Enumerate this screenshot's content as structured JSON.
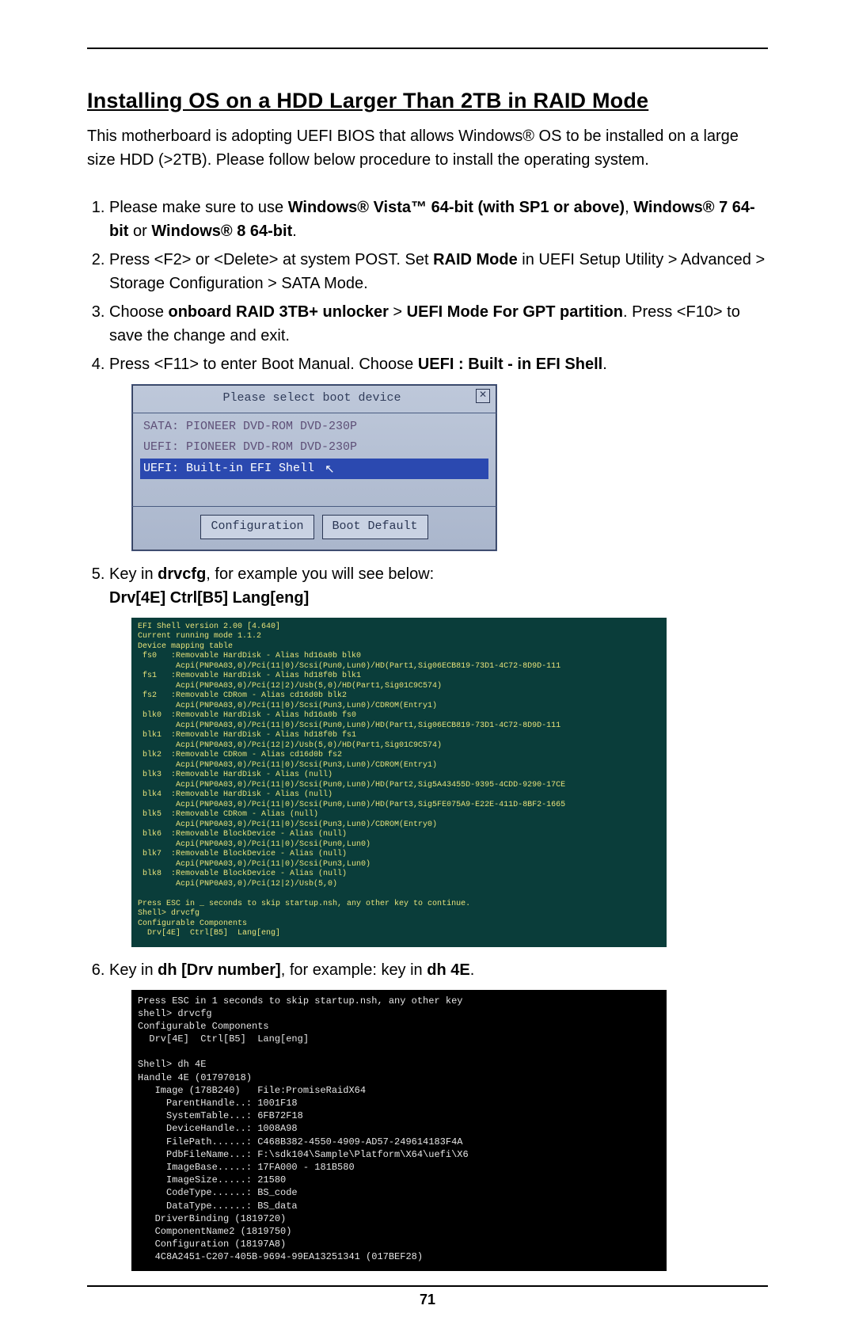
{
  "title": "Installing OS on a HDD Larger Than 2TB in RAID Mode",
  "intro": "This motherboard is adopting UEFI BIOS that allows Windows® OS to be installed on a large size HDD (>2TB). Please follow below procedure to install the operating system.",
  "steps": {
    "s1a": "Please make sure to use ",
    "s1b": "Windows® Vista™ 64-bit (with SP1 or above)",
    "s1c": ", ",
    "s1d": "Windows® 7 64-bit",
    "s1e": " or ",
    "s1f": "Windows® 8 64-bit",
    "s1g": ".",
    "s2a": "Press <F2> or <Delete> at system POST. Set ",
    "s2b": "RAID Mode",
    "s2c": " in UEFI Setup Utility > Advanced > Storage Configuration > SATA Mode.",
    "s3a": "Choose ",
    "s3b": "onboard RAID 3TB+ unlocker",
    "s3c": " > ",
    "s3d": "UEFI Mode For GPT partition",
    "s3e": ". Press <F10> to save the change and exit.",
    "s4a": "Press <F11> to enter Boot Manual. Choose ",
    "s4b": "UEFI : Built - in EFI Shell",
    "s4c": ".",
    "s5a": "Key in ",
    "s5b": "drvcfg",
    "s5c": ", for example you will see below:",
    "s5d": "Drv[4E]   Ctrl[B5]   Lang[eng]",
    "s6a": "Key in ",
    "s6b": "dh [Drv number]",
    "s6c": ", for example: key in ",
    "s6d": "dh 4E",
    "s6e": "."
  },
  "boot_menu": {
    "header": "Please select boot device",
    "items": [
      "SATA: PIONEER DVD-ROM DVD-230P",
      "UEFI: PIONEER DVD-ROM DVD-230P",
      "UEFI: Built-in EFI Shell"
    ],
    "selected_index": 2,
    "btn_config": "Configuration",
    "btn_default": "Boot Default",
    "close_glyph": "✕"
  },
  "shell1": "EFI Shell version 2.00 [4.640]\nCurrent running mode 1.1.2\nDevice mapping table\n fs0   :Removable HardDisk - Alias hd16a0b blk0\n        Acpi(PNP0A03,0)/Pci(11|0)/Scsi(Pun0,Lun0)/HD(Part1,Sig06ECB819-73D1-4C72-8D9D-111\n fs1   :Removable HardDisk - Alias hd18f0b blk1\n        Acpi(PNP0A03,0)/Pci(12|2)/Usb(5,0)/HD(Part1,Sig01C9C574)\n fs2   :Removable CDRom - Alias cd16d0b blk2\n        Acpi(PNP0A03,0)/Pci(11|0)/Scsi(Pun3,Lun0)/CDROM(Entry1)\n blk0  :Removable HardDisk - Alias hd16a0b fs0\n        Acpi(PNP0A03,0)/Pci(11|0)/Scsi(Pun0,Lun0)/HD(Part1,Sig06ECB819-73D1-4C72-8D9D-111\n blk1  :Removable HardDisk - Alias hd18f0b fs1\n        Acpi(PNP0A03,0)/Pci(12|2)/Usb(5,0)/HD(Part1,Sig01C9C574)\n blk2  :Removable CDRom - Alias cd16d0b fs2\n        Acpi(PNP0A03,0)/Pci(11|0)/Scsi(Pun3,Lun0)/CDROM(Entry1)\n blk3  :Removable HardDisk - Alias (null)\n        Acpi(PNP0A03,0)/Pci(11|0)/Scsi(Pun0,Lun0)/HD(Part2,Sig5A43455D-9395-4CDD-9290-17CE\n blk4  :Removable HardDisk - Alias (null)\n        Acpi(PNP0A03,0)/Pci(11|0)/Scsi(Pun0,Lun0)/HD(Part3,Sig5FE075A9-E22E-411D-8BF2-1665\n blk5  :Removable CDRom - Alias (null)\n        Acpi(PNP0A03,0)/Pci(11|0)/Scsi(Pun3,Lun0)/CDROM(Entry0)\n blk6  :Removable BlockDevice - Alias (null)\n        Acpi(PNP0A03,0)/Pci(11|0)/Scsi(Pun0,Lun0)\n blk7  :Removable BlockDevice - Alias (null)\n        Acpi(PNP0A03,0)/Pci(11|0)/Scsi(Pun3,Lun0)\n blk8  :Removable BlockDevice - Alias (null)\n        Acpi(PNP0A03,0)/Pci(12|2)/Usb(5,0)\n\nPress ESC in _ seconds to skip startup.nsh, any other key to continue.\nShell> drvcfg\nConfigurable Components\n  Drv[4E]  Ctrl[B5]  Lang[eng]",
  "shell2": "Press ESC in 1 seconds to skip startup.nsh, any other key\nshell> drvcfg\nConfigurable Components\n  Drv[4E]  Ctrl[B5]  Lang[eng]\n\nShell> dh 4E\nHandle 4E (01797018)\n   Image (178B240)   File:PromiseRaidX64\n     ParentHandle..: 1001F18\n     SystemTable...: 6FB72F18\n     DeviceHandle..: 1008A98\n     FilePath......: C468B382-4550-4909-AD57-249614183F4A\n     PdbFileName...: F:\\sdk104\\Sample\\Platform\\X64\\uefi\\X6\n     ImageBase.....: 17FA000 - 181B580\n     ImageSize.....: 21580\n     CodeType......: BS_code\n     DataType......: BS_data\n   DriverBinding (1819720)\n   ComponentName2 (1819750)\n   Configuration (18197A8)\n   4C8A2451-C207-405B-9694-99EA13251341 (017BEF28)",
  "shell2_hl1": "Shell> dh 4E",
  "page_number": "71"
}
